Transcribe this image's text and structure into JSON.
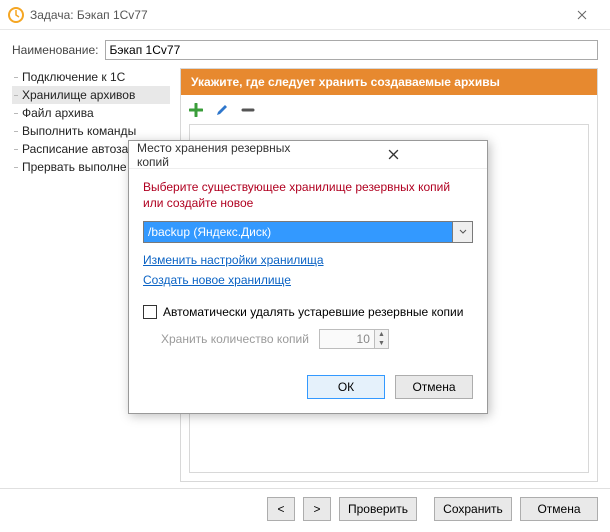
{
  "window": {
    "title": "Задача: Бэкап 1Cv77"
  },
  "name_row": {
    "label": "Наименование:",
    "value": "Бэкап 1Cv77"
  },
  "sidebar": {
    "items": [
      {
        "label": "Подключение к 1С"
      },
      {
        "label": "Хранилище архивов"
      },
      {
        "label": "Файл архива"
      },
      {
        "label": "Выполнить команды"
      },
      {
        "label": "Расписание автоза"
      },
      {
        "label": "Прервать выполне"
      }
    ],
    "selected_index": 1
  },
  "content": {
    "header": "Укажите, где следует хранить создаваемые архивы"
  },
  "toolbar": {
    "add_icon": "plus",
    "edit_icon": "pencil",
    "remove_icon": "minus"
  },
  "footer": {
    "back": "<",
    "forward": ">",
    "check": "Проверить",
    "save": "Сохранить",
    "cancel": "Отмена"
  },
  "modal": {
    "title": "Место хранения резервных копий",
    "hint": "Выберите существующее хранилище резервных копий или создайте новое",
    "combo_value": "/backup (Яндекс.Диск)",
    "link_edit": "Изменить настройки хранилища",
    "link_new": "Создать новое хранилище",
    "auto_delete_label": "Автоматически удалять устаревшие резервные копии",
    "keep_label": "Хранить количество копий",
    "keep_value": "10",
    "ok": "ОК",
    "cancel": "Отмена"
  }
}
